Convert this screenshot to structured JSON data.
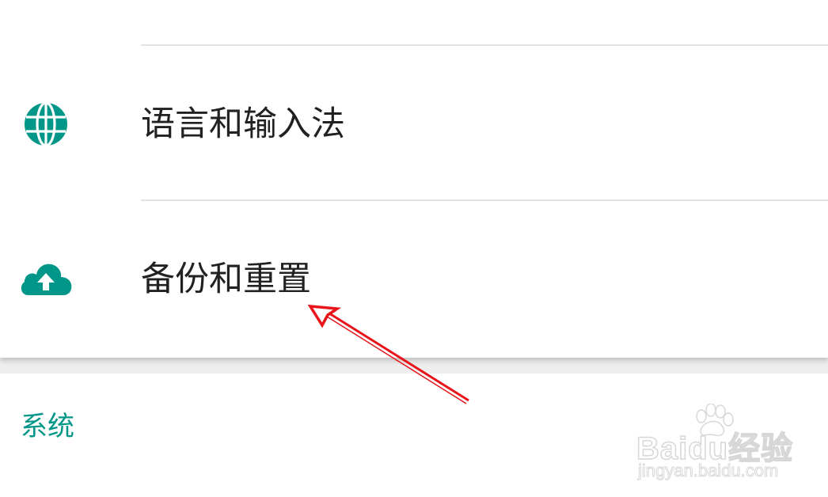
{
  "settings": {
    "items": [
      {
        "label": "语言和输入法",
        "icon": "globe-icon"
      },
      {
        "label": "备份和重置",
        "icon": "cloud-upload-icon"
      }
    ],
    "section_header": "系统"
  },
  "colors": {
    "accent": "#009688",
    "text_primary": "#212121",
    "divider": "#e2e2e2",
    "annotation_arrow": "#e8141a"
  },
  "watermark": {
    "brand": "Baidu经验",
    "url": "jingyan.baidu.com"
  }
}
